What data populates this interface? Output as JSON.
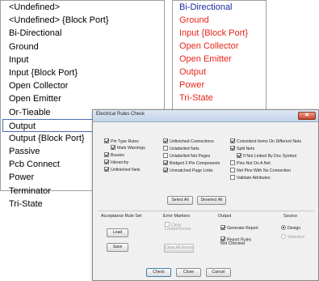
{
  "left_list": {
    "items": [
      "<Undefined>",
      "<Undefined> {Block Port}",
      "Bi-Directional",
      "Ground",
      "Input",
      "Input {Block Port}",
      "Open Collector",
      "Open Emitter",
      "Or-Tieable",
      "Output",
      "Output {Block Port}",
      "Passive",
      "Pcb Connect",
      "Power",
      "Terminator",
      "Tri-State"
    ],
    "selected_index": 9
  },
  "right_list": {
    "items": [
      "Bi-Directional",
      "Ground",
      "Input {Block Port}",
      "Open Collector",
      "Open Emitter",
      "Output",
      "Power",
      "Tri-State"
    ],
    "colors": [
      "#1a2aa0",
      "#e8251b",
      "#e8251b",
      "#e8251b",
      "#e8251b",
      "#e8251b",
      "#e8251b",
      "#e8251b"
    ]
  },
  "dialog": {
    "title": "Electrical Rules Check",
    "close_icon": "close-x-icon",
    "checks": {
      "pin_type_rules": "Pin Type Rules",
      "mark_warnings": "Mark Warnings",
      "busses": "Busses",
      "hierarchy": "Hierarchy",
      "unfinished_nets": "Unfinished Nets",
      "unfinished_connections": "Unfinished Connections",
      "unlabelled_nets": "Unlabelled Nets",
      "unlabelled_net_pages": "Unlabelled Net Pages",
      "bridged_2pin": "Bridged 2-Pin Components",
      "unmatched_page_links": "Unmatched Page Links",
      "coincident_items": "Coincident Items On Different Nets",
      "split_nets": "Split Nets",
      "if_not_linked": "If Not Linked By Doc Symbol",
      "pins_not_on_net": "Pins Not On A Net",
      "net_pins_no_connection": "Net Pins With No Connection",
      "validate_attributes": "Validate Attributes"
    },
    "select_all": "Select All",
    "deselect_all": "Deselect All",
    "acceptance": {
      "label": "Acceptance Rule Set",
      "load": "Load",
      "save": "Save"
    },
    "error_markers": {
      "label": "Error Markers",
      "clear_locked": "Clear Locked Errors",
      "clear_all": "Clear All Errors"
    },
    "output": {
      "label": "Output",
      "generate_report": "Generate Report",
      "report_rules": "Report Rules Not Checked"
    },
    "source": {
      "label": "Source",
      "design": "Design",
      "selection": "Selection"
    },
    "footer": {
      "check": "Check",
      "close": "Close",
      "cancel": "Cancel"
    }
  }
}
